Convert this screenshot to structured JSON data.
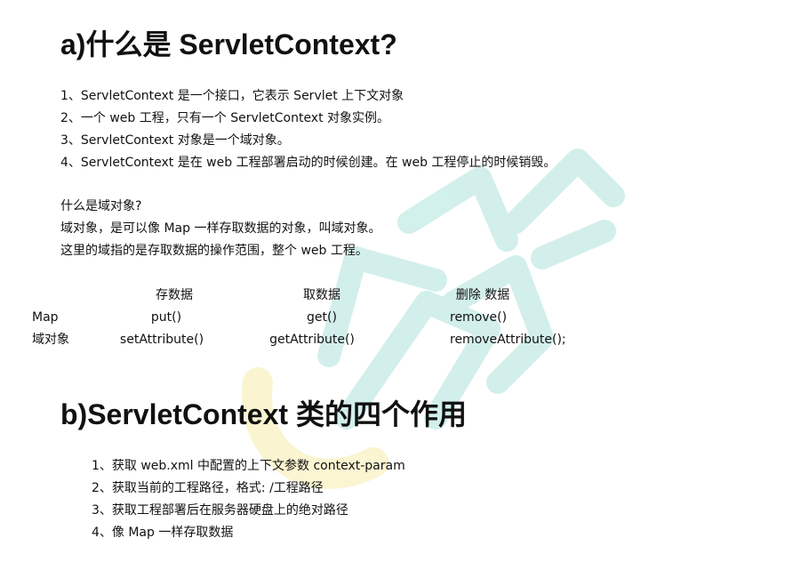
{
  "section_a": {
    "title": "a)什么是 ServletContext?",
    "items": [
      "1、ServletContext 是一个接口，它表示 Servlet 上下文对象",
      "2、一个 web 工程，只有一个 ServletContext 对象实例。",
      "3、ServletContext 对象是一个域对象。",
      "4、ServletContext 是在 web 工程部署启动的时候创建。在 web 工程停止的时候销毁。"
    ],
    "domain_object": {
      "question": "什么是域对象?",
      "lines": [
        "域对象，是可以像 Map 一样存取数据的对象，叫域对象。",
        "这里的域指的是存取数据的操作范围，整个 web 工程。"
      ]
    },
    "comparison": {
      "headers": [
        "",
        "存数据",
        "取数据",
        "删除 数据"
      ],
      "rows": [
        [
          "Map",
          "put()",
          "get()",
          "remove()"
        ],
        [
          "域对象",
          "setAttribute()",
          "getAttribute()",
          "removeAttribute();"
        ]
      ]
    }
  },
  "section_b": {
    "title": "b)ServletContext 类的四个作用",
    "items": [
      "1、获取 web.xml 中配置的上下文参数 context-param",
      "2、获取当前的工程路径，格式: /工程路径",
      "3、获取工程部署后在服务器硬盘上的绝对路径",
      "4、像 Map 一样存取数据"
    ]
  },
  "watermark": {
    "text": "尚硅谷",
    "colors": {
      "teal": "#7fd3c8",
      "yellow": "#f3e27a"
    }
  }
}
